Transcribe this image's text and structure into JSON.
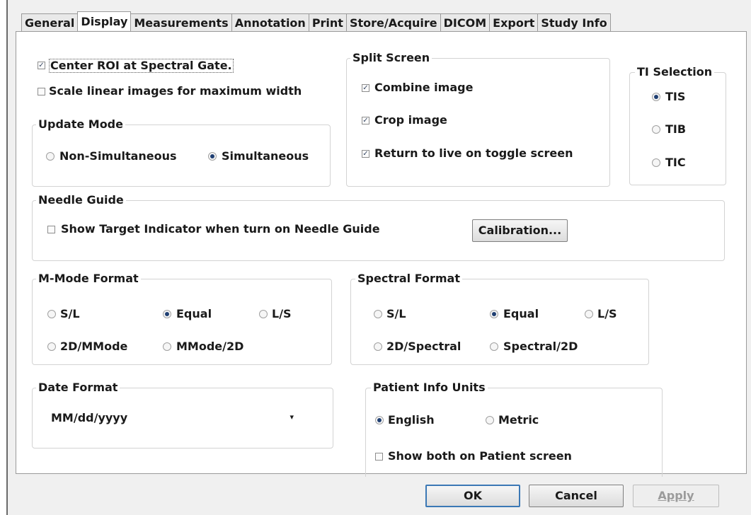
{
  "tabs": [
    "General",
    "Display",
    "Measurements",
    "Annotation",
    "Print",
    "Store/Acquire",
    "DICOM",
    "Export",
    "Study Info"
  ],
  "active_tab": "Display",
  "options": {
    "center_roi": {
      "label": "Center ROI at Spectral Gate.",
      "checked": true
    },
    "scale_linear": {
      "label": "Scale linear images for maximum width",
      "checked": false
    }
  },
  "update_mode": {
    "title": "Update Mode",
    "non_simultaneous": "Non-Simultaneous",
    "simultaneous": "Simultaneous",
    "selected": "Simultaneous"
  },
  "split_screen": {
    "title": "Split Screen",
    "combine": "Combine image",
    "crop": "Crop image",
    "return_live": "Return to live on toggle screen"
  },
  "ti_selection": {
    "title": "TI Selection",
    "tis": "TIS",
    "tib": "TIB",
    "tic": "TIC",
    "selected": "TIS"
  },
  "needle_guide": {
    "title": "Needle Guide",
    "show_target": "Show Target Indicator when turn on Needle Guide",
    "calibration": "Calibration..."
  },
  "mmode_format": {
    "title": "M-Mode Format",
    "sl": "S/L",
    "equal": "Equal",
    "ls": "L/S",
    "2d_mmode": "2D/MMode",
    "mmode_2d": "MMode/2D",
    "selected": "Equal"
  },
  "spectral_format": {
    "title": "Spectral Format",
    "sl": "S/L",
    "equal": "Equal",
    "ls": "L/S",
    "2d_spectral": "2D/Spectral",
    "spectral_2d": "Spectral/2D",
    "selected": "Equal"
  },
  "date_format": {
    "title": "Date Format",
    "value": "MM/dd/yyyy"
  },
  "patient_info_units": {
    "title": "Patient Info Units",
    "english": "English",
    "metric": "Metric",
    "selected": "English",
    "show_both": "Show both on Patient screen"
  },
  "buttons": {
    "ok": "OK",
    "cancel": "Cancel",
    "apply": "Apply"
  }
}
